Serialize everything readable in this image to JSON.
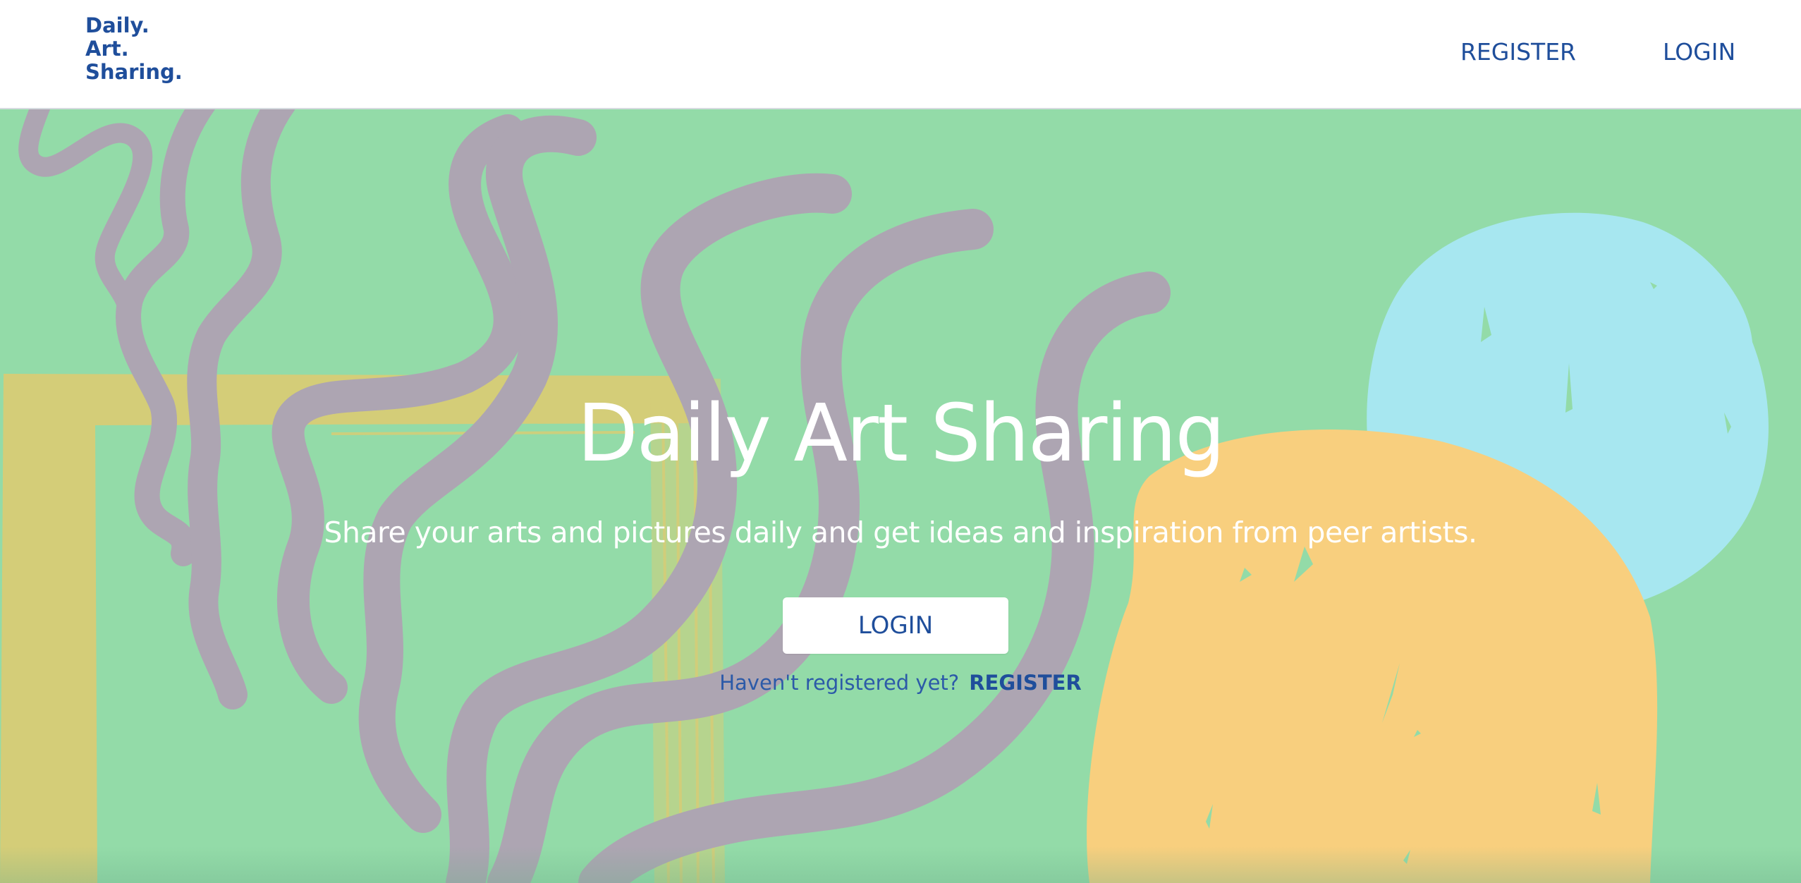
{
  "brand": {
    "logo_lines": [
      "Daily.",
      "Art.",
      "Sharing."
    ]
  },
  "navbar": {
    "register_label": "REGISTER",
    "login_label": "LOGIN"
  },
  "hero": {
    "title": "Daily Art Sharing",
    "subtitle": "Share your arts and pictures daily and get ideas and inspiration from peer artists.",
    "login_button_label": "LOGIN",
    "register_prompt": "Haven't registered yet?",
    "register_link_label": "REGISTER"
  },
  "colors": {
    "brand_blue": "#1f4e9b",
    "hero_green": "#93dba8",
    "squiggle_mauve": "#ada5b2",
    "frame_yellow": "#d4cd78",
    "circle_blue": "#a7e7f0",
    "circle_orange": "#f8cf7e",
    "white": "#ffffff"
  },
  "icons": {
    "background_art": "abstract-art-illustration"
  }
}
